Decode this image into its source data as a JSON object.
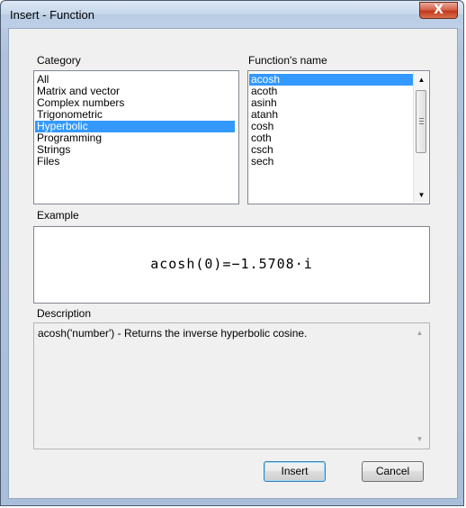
{
  "window": {
    "title": "Insert - Function",
    "close_glyph": "X"
  },
  "category": {
    "label": "Category",
    "items": [
      "All",
      "Matrix and vector",
      "Complex numbers",
      "Trigonometric",
      "Hyperbolic",
      "Programming",
      "Strings",
      "Files"
    ],
    "selected": "Hyperbolic"
  },
  "functions": {
    "label": "Function's name",
    "items": [
      "acosh",
      "acoth",
      "asinh",
      "atanh",
      "cosh",
      "coth",
      "csch",
      "sech"
    ],
    "selected": "acosh"
  },
  "example": {
    "label": "Example",
    "formula": "acosh(0)=−1.5708·i"
  },
  "description": {
    "label": "Description",
    "text": "acosh('number') - Returns the inverse hyperbolic cosine."
  },
  "buttons": {
    "insert": "Insert",
    "cancel": "Cancel"
  },
  "icons": {
    "close": "close-icon",
    "scroll_up": "scroll-up-icon",
    "scroll_down": "scroll-down-icon"
  }
}
